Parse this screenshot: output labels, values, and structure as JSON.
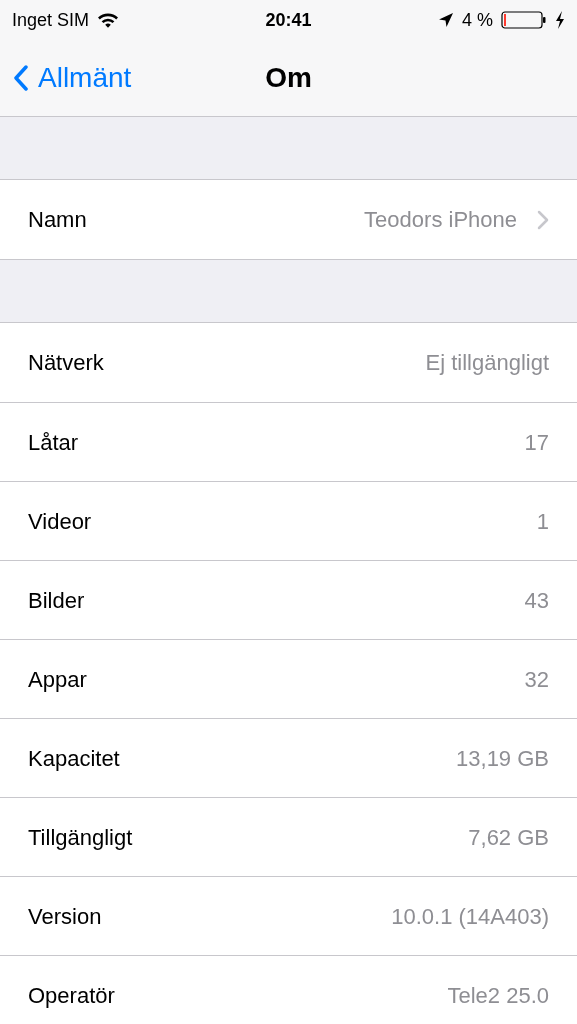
{
  "status_bar": {
    "carrier": "Inget SIM",
    "time": "20:41",
    "battery_percent": "4 %",
    "charging": true
  },
  "nav": {
    "back": "Allmänt",
    "title": "Om"
  },
  "sections": [
    {
      "rows": [
        {
          "label": "Namn",
          "value": "Teodors iPhone",
          "disclosure": true
        }
      ]
    },
    {
      "rows": [
        {
          "label": "Nätverk",
          "value": "Ej tillgängligt",
          "disclosure": false
        },
        {
          "label": "Låtar",
          "value": "17",
          "disclosure": false
        },
        {
          "label": "Videor",
          "value": "1",
          "disclosure": false
        },
        {
          "label": "Bilder",
          "value": "43",
          "disclosure": false
        },
        {
          "label": "Appar",
          "value": "32",
          "disclosure": false
        },
        {
          "label": "Kapacitet",
          "value": "13,19 GB",
          "disclosure": false
        },
        {
          "label": "Tillgängligt",
          "value": "7,62 GB",
          "disclosure": false
        },
        {
          "label": "Version",
          "value": "10.0.1 (14A403)",
          "disclosure": false
        },
        {
          "label": "Operatör",
          "value": "Tele2 25.0",
          "disclosure": false
        }
      ]
    }
  ]
}
